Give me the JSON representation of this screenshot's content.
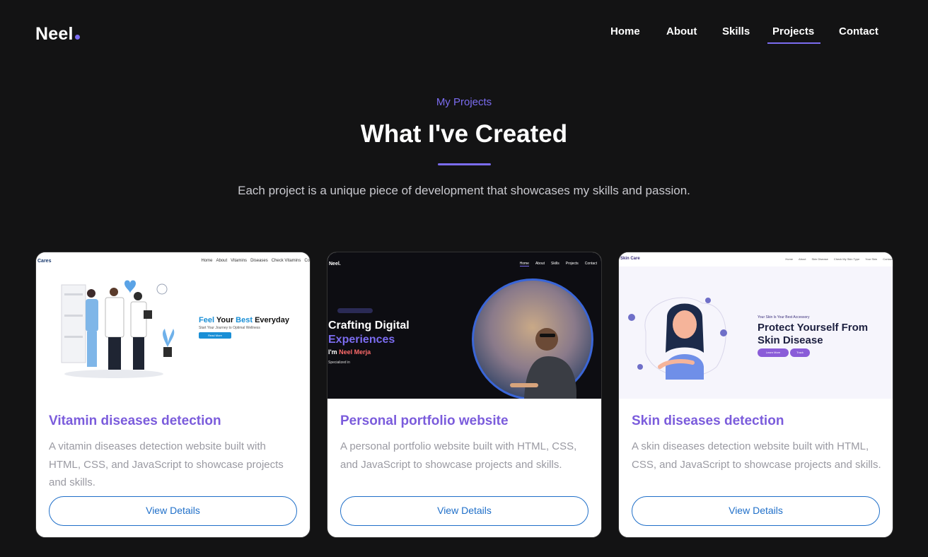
{
  "nav": {
    "logo": "Neel",
    "items": [
      "Home",
      "About",
      "Skills",
      "Projects",
      "Contact"
    ],
    "active": "Projects"
  },
  "section": {
    "subhead": "My Projects",
    "heading": "What I've Created",
    "intro": "Each project is a unique piece of development that showcases my skills and passion."
  },
  "projects": [
    {
      "title": "Vitamin diseases detection",
      "description": "A vitamin diseases detection website built with HTML, CSS, and JavaScript to showcase projects and skills.",
      "button": "View Details",
      "thumb": {
        "brand": "Cares",
        "nav": [
          "Home",
          "About",
          "Vitamins",
          "Diseases",
          "Check Vitamins",
          "Co"
        ],
        "headline_a": "Feel",
        "headline_b": " Your ",
        "headline_c": "Best",
        "headline_d": " Everyday",
        "sub": "Start Your Journey to Optimal Wellness",
        "cta": "Read More"
      }
    },
    {
      "title": "Personal portfolio website",
      "description": "A personal portfolio website built with HTML, CSS, and JavaScript to showcase projects and skills.",
      "button": "View Details",
      "thumb": {
        "brand": "Neel.",
        "nav": [
          "Home",
          "About",
          "Skills",
          "Projects",
          "Contact"
        ],
        "line1": "Crafting Digital",
        "line2": "Experiences",
        "im": "I'm ",
        "name": "Neel Merja",
        "spec": "Specialized in"
      }
    },
    {
      "title": "Skin diseases detection",
      "description": "A skin diseases detection website built with HTML, CSS, and JavaScript to showcase projects and skills.",
      "button": "View Details",
      "thumb": {
        "brand": "Skin Care",
        "nav": [
          "Home",
          "About",
          "Skin Disease",
          "Check My Skin Type",
          "Your Skin",
          "Contact"
        ],
        "tag": "Your Skin Is Your Best Accessory",
        "headline": "Protect Yourself From Skin Disease",
        "btn1": "Learn More",
        "btn2": "Track"
      }
    }
  ],
  "colors": {
    "background": "#131314",
    "accent": "#7b6cf0",
    "card_title": "#7b5cdc",
    "button": "#1f6fc9"
  }
}
